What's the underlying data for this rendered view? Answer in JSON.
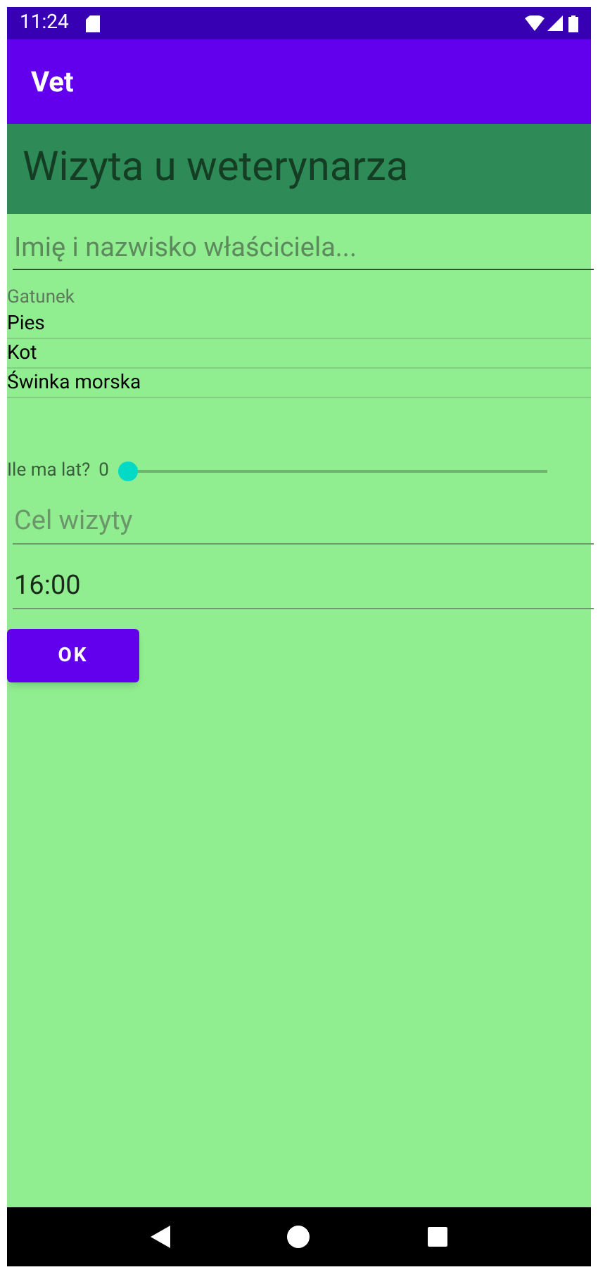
{
  "status_bar": {
    "time": "11:24"
  },
  "app_bar": {
    "title": "Vet"
  },
  "header": {
    "title": "Wizyta u weterynarza"
  },
  "owner_field": {
    "placeholder": "Imię i nazwisko właściciela..."
  },
  "species": {
    "label": "Gatunek",
    "items": [
      {
        "label": "Pies"
      },
      {
        "label": "Kot"
      },
      {
        "label": "Świnka morska"
      }
    ]
  },
  "age": {
    "label": "Ile ma lat?",
    "value": "0",
    "level": 0
  },
  "purpose_field": {
    "placeholder": "Cel wizyty"
  },
  "time_field": {
    "value": "16:00"
  },
  "ok_button": {
    "label": "OK"
  }
}
